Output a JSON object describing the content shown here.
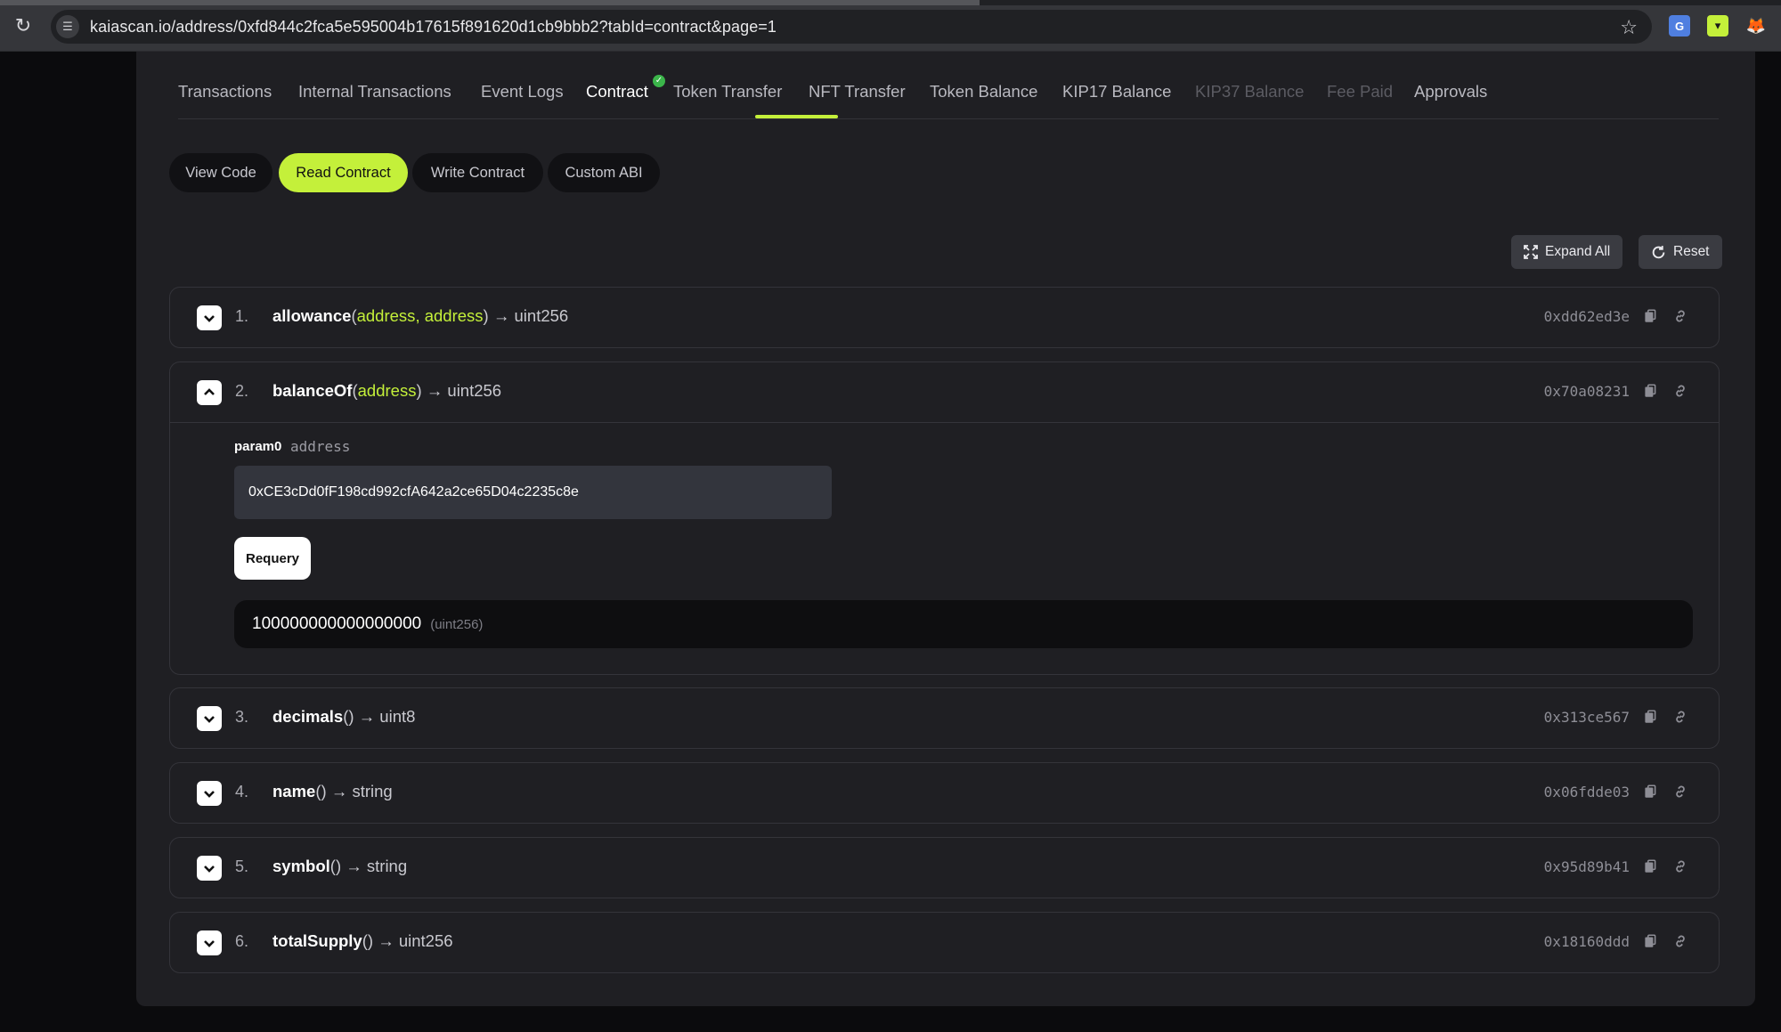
{
  "browser": {
    "url": "kaiascan.io/address/0xfd844c2fca5e595004b17615f891620d1cb9bbb2?tabId=contract&page=1"
  },
  "tabs": [
    {
      "label": "Transactions"
    },
    {
      "label": "Internal Transactions"
    },
    {
      "label": "Event Logs"
    },
    {
      "label": "Contract"
    },
    {
      "label": "Token Transfer"
    },
    {
      "label": "NFT Transfer"
    },
    {
      "label": "Token Balance"
    },
    {
      "label": "KIP17 Balance"
    },
    {
      "label": "KIP37 Balance"
    },
    {
      "label": "Fee Paid"
    },
    {
      "label": "Approvals"
    }
  ],
  "active_tab": "Contract",
  "subtabs": [
    {
      "label": "View Code"
    },
    {
      "label": "Read Contract"
    },
    {
      "label": "Write Contract"
    },
    {
      "label": "Custom ABI"
    }
  ],
  "actions": {
    "expand_all": "Expand All",
    "reset": "Reset"
  },
  "functions": [
    {
      "num": "1.",
      "name": "allowance",
      "args": [
        "address",
        "address"
      ],
      "returns": "uint256",
      "selector": "0xdd62ed3e"
    },
    {
      "num": "2.",
      "name": "balanceOf",
      "args": [
        "address"
      ],
      "returns": "uint256",
      "selector": "0x70a08231"
    },
    {
      "num": "3.",
      "name": "decimals",
      "args": [],
      "returns": "uint8",
      "selector": "0x313ce567"
    },
    {
      "num": "4.",
      "name": "name",
      "args": [],
      "returns": "string",
      "selector": "0x06fdde03"
    },
    {
      "num": "5.",
      "name": "symbol",
      "args": [],
      "returns": "string",
      "selector": "0x95d89b41"
    },
    {
      "num": "6.",
      "name": "totalSupply",
      "args": [],
      "returns": "uint256",
      "selector": "0x18160ddd"
    }
  ],
  "expanded": {
    "param_label": "param0",
    "param_type": "address",
    "input_value": "0xCE3cDd0fF198cd992cfA642a2ce65D04c2235c8e",
    "requery_label": "Requery",
    "result_value": "100000000000000000",
    "result_type": "(uint256)"
  },
  "colors": {
    "accent": "#c4f03a",
    "verified": "#3bb54a"
  }
}
